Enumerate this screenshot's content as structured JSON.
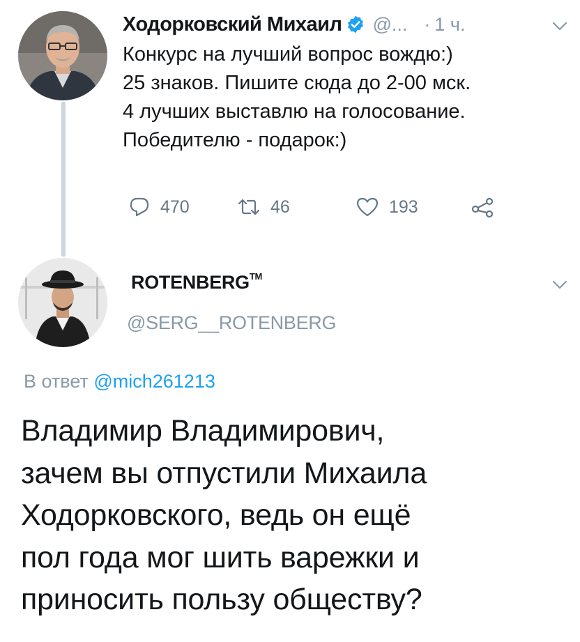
{
  "tweet1": {
    "author_name": "Ходорковский Михаил",
    "handle": "@...",
    "dot": "·",
    "time": "1 ч.",
    "body_lines": [
      "Конкурс на лучший вопрос вождю:)",
      "25 знаков. Пишите сюда до 2-00 мск.",
      "4 лучших выставлю на голосование.",
      "Победителю - подарок:)"
    ],
    "reply_count": "470",
    "retweet_count": "46",
    "like_count": "193"
  },
  "tweet2": {
    "author_name": "ROTENBERG",
    "trademark": "TM",
    "handle": "@SERG__ROTENBERG",
    "reply_prefix": "В ответ",
    "reply_mention": "@mich261213",
    "body_lines": [
      "Владимир Владимирович,",
      "зачем вы отпустили Михаила",
      "Ходорковского, ведь он ещё",
      "пол года мог шить варежки и",
      "приносить пользу обществу?"
    ]
  },
  "colors": {
    "text": "#14171a",
    "secondary": "#8899a6",
    "icon": "#657786",
    "link": "#1da1f2",
    "verified": "#1da1f2",
    "thread_line": "#ccd6dd"
  },
  "icons": [
    "verified-badge",
    "chevron-down",
    "reply",
    "retweet",
    "like",
    "share"
  ]
}
